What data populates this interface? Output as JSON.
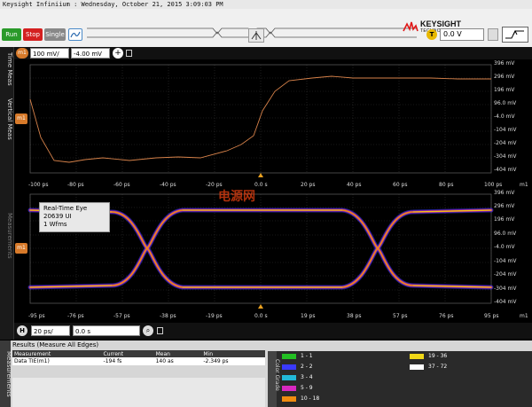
{
  "title_bar": "Keysight Infiniium : Wednesday, October 21, 2015 3:09:03 PM",
  "brand": {
    "name": "KEYSIGHT",
    "sub": "TECHNOLOGIES"
  },
  "toolbar": {
    "run": "Run",
    "stop": "Stop",
    "single": "Single",
    "trigger_level": "0.0 V",
    "trigger_label": "T"
  },
  "side_tabs": {
    "time_meas": "Time Meas",
    "vertical_meas": "Vertical Meas",
    "measurements": "Measurements"
  },
  "channel": {
    "label": "m1",
    "scale": "100 mV/",
    "offset": "-4.00 mV"
  },
  "top_plot": {
    "y_ticks": [
      "396 mV",
      "296 mV",
      "196 mV",
      "96.0 mV",
      "-4.0 mV",
      "-104 mV",
      "-204 mV",
      "-304 mV",
      "-404 mV"
    ],
    "x_ticks": [
      "-100 ps",
      "-80 ps",
      "-60 ps",
      "-40 ps",
      "-20 ps",
      "0.0 s",
      "20 ps",
      "40 ps",
      "60 ps",
      "80 ps",
      "100 ps"
    ],
    "x_unit": "m1",
    "trace_color": "#d7824a"
  },
  "bottom_plot": {
    "y_ticks": [
      "396 mV",
      "296 mV",
      "196 mV",
      "96.0 mV",
      "-4.0 mV",
      "-104 mV",
      "-204 mV",
      "-304 mV",
      "-404 mV"
    ],
    "x_ticks": [
      "-95 ps",
      "-76 ps",
      "-57 ps",
      "-38 ps",
      "-19 ps",
      "0.0 s",
      "19 ps",
      "38 ps",
      "57 ps",
      "76 ps",
      "95 ps"
    ],
    "x_unit": "m1",
    "info": {
      "line1": "Real-Time Eye",
      "line2": "20639 UI",
      "line3": "1 Wfms"
    }
  },
  "watermark": "电源网",
  "timebase": {
    "label": "H",
    "scale": "20 ps/",
    "delay": "0.0 s"
  },
  "results": {
    "title": "Results (Measure All Edges)",
    "side_label": "Measurements",
    "columns": [
      "Measurement",
      "Current",
      "Mean",
      "Min"
    ],
    "rows": [
      {
        "name": "Data TIE(m1)",
        "current": "-194 fs",
        "mean": "140 as",
        "min": "-2.349 ps"
      }
    ]
  },
  "color_grade": {
    "label": "Color Grade",
    "entries": [
      {
        "range": "1 - 1",
        "color": "#22c022"
      },
      {
        "range": "2 - 2",
        "color": "#3a3aff"
      },
      {
        "range": "3 - 4",
        "color": "#22b8d8"
      },
      {
        "range": "5 - 9",
        "color": "#d828c0"
      },
      {
        "range": "10 - 18",
        "color": "#f08c10"
      },
      {
        "range": "19 - 36",
        "color": "#f0d818"
      },
      {
        "range": "37 - 72",
        "color": "#ffffff"
      }
    ]
  }
}
